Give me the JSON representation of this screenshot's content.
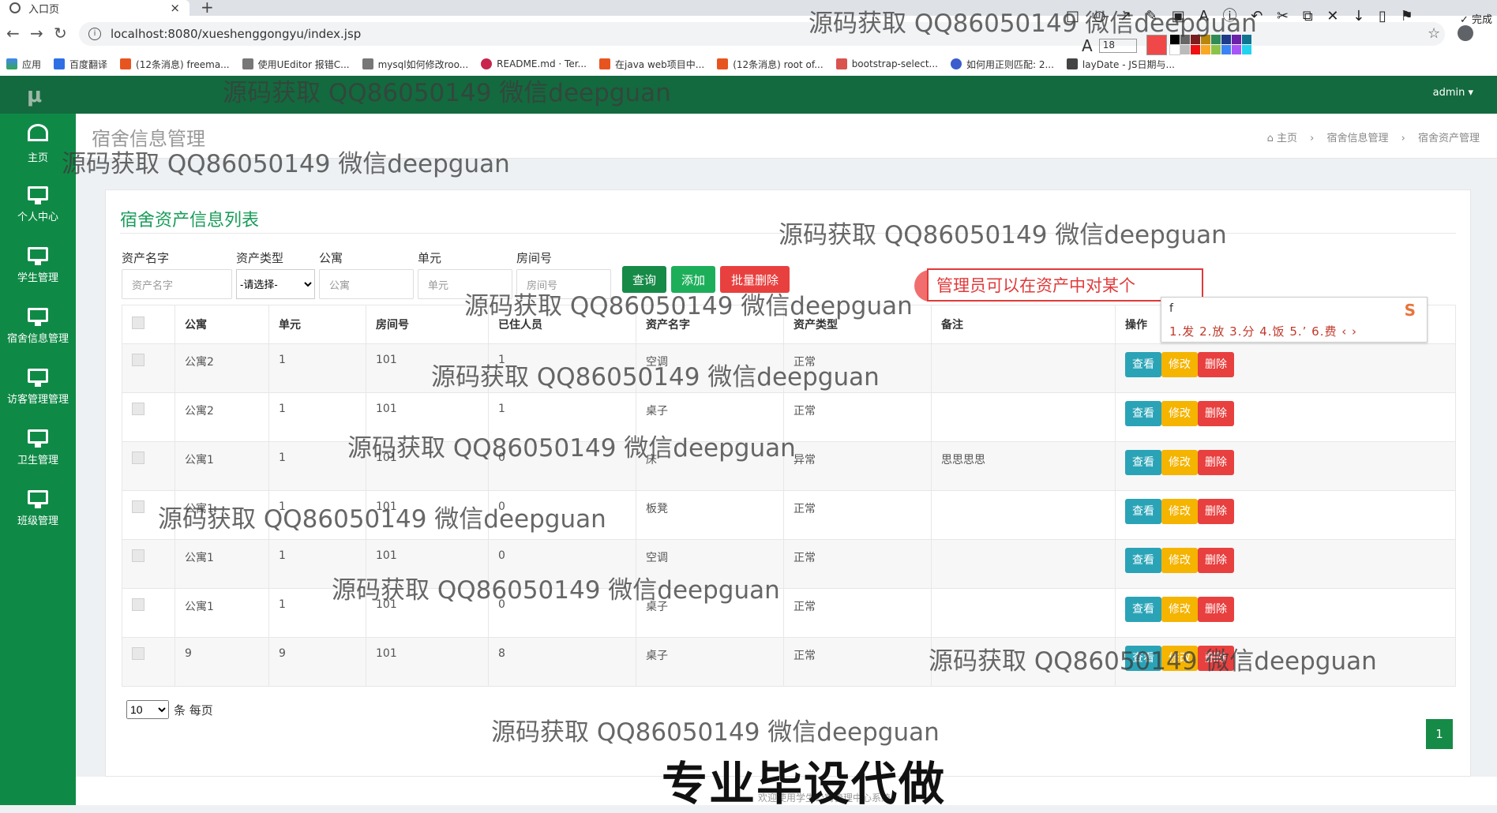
{
  "browser": {
    "tab_title": "入口页",
    "new_tab": "+",
    "url": "localhost:8080/xueshenggongyu/index.jsp",
    "bookmarks": [
      "应用",
      "百度翻译",
      "(12条消息) freema...",
      "使用UEditor 报错C...",
      "mysql如何修改roo...",
      "README.md · Ter...",
      "在java web项目中...",
      "(12条消息) root of...",
      "bootstrap-select...",
      "如何用正则匹配: 2...",
      "layDate - JS日期与..."
    ]
  },
  "annotation_tool": {
    "done_label": "完成",
    "font_size": "18",
    "colors": [
      "#f04848"
    ]
  },
  "app": {
    "logo": "μ",
    "user": "admin ▾",
    "sidebar": [
      {
        "label": "主页",
        "icon": "dashboard-icon"
      },
      {
        "label": "个人中心",
        "icon": "monitor-icon"
      },
      {
        "label": "学生管理",
        "icon": "monitor-icon"
      },
      {
        "label": "宿舍信息管理",
        "icon": "monitor-icon"
      },
      {
        "label": "访客管理管理",
        "icon": "monitor-icon"
      },
      {
        "label": "卫生管理",
        "icon": "monitor-icon"
      },
      {
        "label": "班级管理",
        "icon": "monitor-icon"
      }
    ],
    "page_title": "宿舍信息管理",
    "breadcrumb": [
      "主页",
      "宿舍信息管理",
      "宿舍资产管理"
    ],
    "panel_title": "宿舍资产信息列表",
    "filters": {
      "asset_name": {
        "label": "资产名字",
        "placeholder": "资产名字"
      },
      "asset_type": {
        "label": "资产类型",
        "value": "-请选择-"
      },
      "apartment": {
        "label": "公寓",
        "placeholder": "公寓"
      },
      "unit": {
        "label": "单元",
        "placeholder": "单元"
      },
      "room": {
        "label": "房间号",
        "placeholder": "房间号"
      }
    },
    "buttons": {
      "query": "查询",
      "add": "添加",
      "batch_delete": "批量删除"
    },
    "ime": {
      "text": "管理员可以在资产中对某个",
      "input": "f",
      "candidates": "1.发  2.放  3.分  4.饭  5.’  6.费  ‹ ›"
    },
    "table": {
      "headers": [
        "",
        "公寓",
        "单元",
        "房间号",
        "已住人员",
        "资产名字",
        "资产类型",
        "备注",
        "操作"
      ],
      "rows": [
        [
          "公寓2",
          "1",
          "101",
          "1",
          "空调",
          "正常",
          ""
        ],
        [
          "公寓2",
          "1",
          "101",
          "1",
          "桌子",
          "正常",
          ""
        ],
        [
          "公寓1",
          "1",
          "101",
          "0",
          "床",
          "异常",
          "思思思思"
        ],
        [
          "公寓1",
          "1",
          "101",
          "0",
          "板凳",
          "正常",
          ""
        ],
        [
          "公寓1",
          "1",
          "101",
          "0",
          "空调",
          "正常",
          ""
        ],
        [
          "公寓1",
          "1",
          "101",
          "0",
          "桌子",
          "正常",
          ""
        ],
        [
          "9",
          "9",
          "101",
          "8",
          "桌子",
          "正常",
          ""
        ]
      ],
      "actions": {
        "view": "查看",
        "edit": "修改",
        "delete": "删除"
      }
    },
    "pager": {
      "page_size": "10",
      "per_page_text": "条 每页",
      "current_page": "1"
    },
    "footer": "欢迎使用学生公寓管理中心系统"
  },
  "overlays": {
    "watermark": "源码获取 QQ86050149 微信deepguan",
    "promo": "专业毕设代做"
  }
}
